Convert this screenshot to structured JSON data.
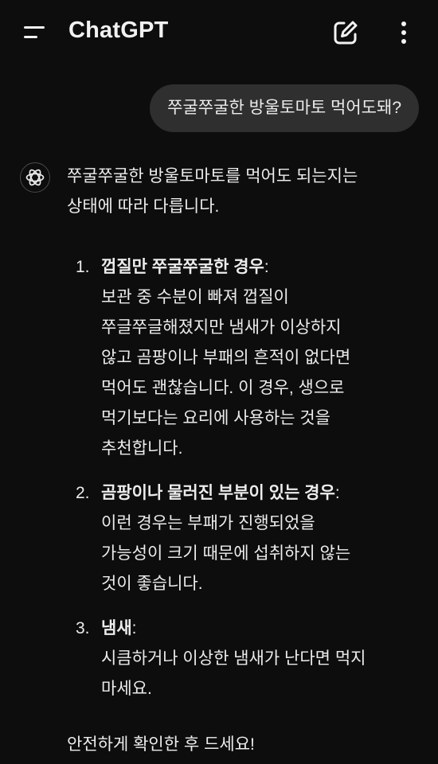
{
  "header": {
    "title": "ChatGPT",
    "menu_icon": "menu-icon",
    "new_chat_icon": "edit-icon",
    "more_icon": "more-vertical-icon"
  },
  "user_message": "쭈굴쭈굴한 방울토마토 먹어도돼?",
  "assistant": {
    "avatar_icon": "openai-logo-icon",
    "intro_line1": "쭈굴쭈굴한 방울토마토를 먹어도 되는지는",
    "intro_line2": "상태에 따라 다릅니다.",
    "items": [
      {
        "num": "1.",
        "heading": "껍질만 쭈굴쭈굴한 경우",
        "colon": ":",
        "lines": [
          "보관 중 수분이 빠져 껍질이",
          "쭈글쭈글해졌지만 냄새가 이상하지",
          "않고 곰팡이나 부패의 흔적이 없다면",
          "먹어도 괜찮습니다. 이 경우, 생으로",
          "먹기보다는 요리에 사용하는 것을",
          "추천합니다."
        ]
      },
      {
        "num": "2.",
        "heading": "곰팡이나 물러진 부분이 있는 경우",
        "colon": ":",
        "lines": [
          "이런 경우는 부패가 진행되었을",
          "가능성이 크기 때문에 섭취하지 않는",
          "것이 좋습니다."
        ]
      },
      {
        "num": "3.",
        "heading": "냄새",
        "colon": ":",
        "lines": [
          "시큼하거나 이상한 냄새가 난다면 먹지",
          "마세요."
        ]
      }
    ],
    "outro": "안전하게 확인한 후 드세요!"
  },
  "colors": {
    "background": "#0d0d0d",
    "bubble": "#2f2f2f",
    "text": "#ececec"
  }
}
